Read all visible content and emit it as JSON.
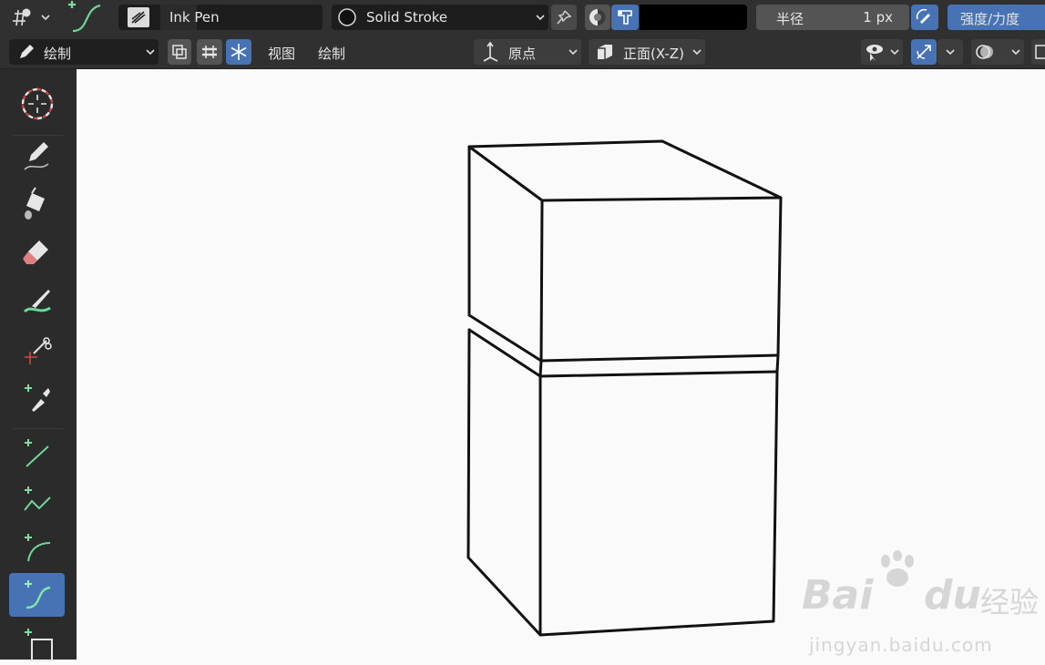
{
  "header": {
    "brush_name": "Ink Pen",
    "material_name": "Solid Stroke",
    "radius_label": "半径",
    "radius_value": "1 px",
    "strength_label": "强度/力度",
    "color_hex": "#000000"
  },
  "header2": {
    "mode_label": "绘制",
    "menu_view": "视图",
    "menu_draw": "绘制",
    "origin_label": "原点",
    "plane_label": "正面(X-Z)"
  },
  "toolbar": {
    "tools": [
      {
        "name": "cursor",
        "active": false
      },
      {
        "name": "draw",
        "active": false
      },
      {
        "name": "fill",
        "active": false
      },
      {
        "name": "erase",
        "active": false
      },
      {
        "name": "tint",
        "active": false
      },
      {
        "name": "cutter",
        "active": false
      },
      {
        "name": "eyedropper",
        "active": false
      },
      {
        "name": "line",
        "active": false
      },
      {
        "name": "polyline",
        "active": false
      },
      {
        "name": "arc",
        "active": false
      },
      {
        "name": "curve",
        "active": true
      },
      {
        "name": "box",
        "active": false
      }
    ]
  },
  "watermark": {
    "brand_latin": "Bai",
    "brand_du": "du",
    "brand_cn": "经验",
    "url": "jingyan.baidu.com"
  },
  "colors": {
    "header_bg": "#303030",
    "toolbar_bg": "#2b2b2b",
    "viewport_bg": "#fafafa",
    "accent_blue": "#4772b3",
    "stroke_green": "#6fd69a"
  }
}
